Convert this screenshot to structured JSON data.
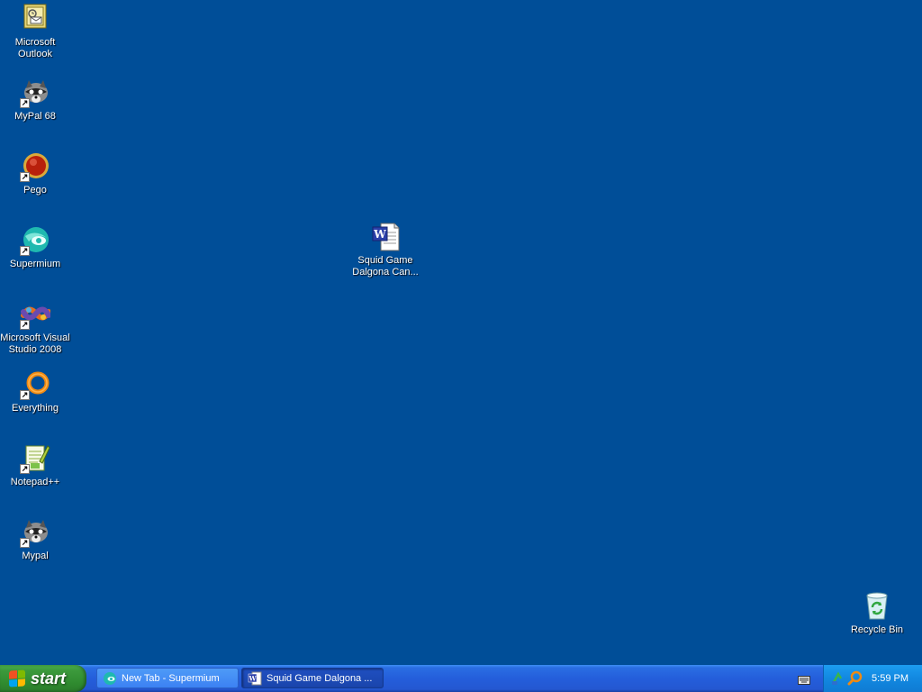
{
  "desktop": {
    "icons": [
      {
        "label": "Microsoft\nOutlook",
        "icon": "outlook-icon"
      },
      {
        "label": "MyPal 68",
        "icon": "mypal-icon"
      },
      {
        "label": "Pego",
        "icon": "pego-icon"
      },
      {
        "label": "Supermium",
        "icon": "supermium-icon"
      },
      {
        "label": "Microsoft Visual\nStudio 2008",
        "icon": "visual-studio-icon"
      },
      {
        "label": "Everything",
        "icon": "everything-icon"
      },
      {
        "label": "Notepad++",
        "icon": "notepadpp-icon"
      },
      {
        "label": "Mypal",
        "icon": "mypal-icon"
      },
      {
        "label": "Squid Game\nDalgona Can...",
        "icon": "word-document-icon"
      },
      {
        "label": "Recycle Bin",
        "icon": "recycle-bin-icon"
      }
    ]
  },
  "taskbar": {
    "start_label": "start",
    "tasks": [
      {
        "label": "New Tab - Supermium",
        "icon": "supermium-icon"
      },
      {
        "label": "Squid Game Dalgona ...",
        "icon": "word-icon"
      }
    ],
    "clock": "5:59 PM"
  },
  "colors": {
    "desktop": "#004e98",
    "start_green": "#3c9a3c",
    "taskbar_blue": "#245edb"
  }
}
